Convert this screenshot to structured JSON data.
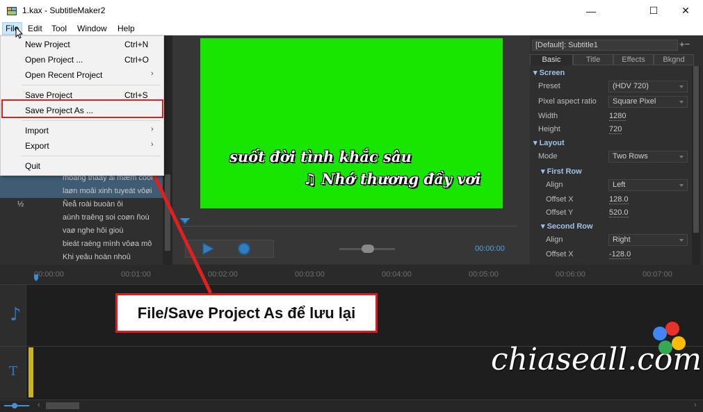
{
  "window": {
    "title": "1.kax - SubtitleMaker2",
    "minimize": "—",
    "maximize": "☐",
    "close": "✕"
  },
  "menubar": [
    "File",
    "Edit",
    "Tool",
    "Window",
    "Help"
  ],
  "file_menu": {
    "items": [
      {
        "label": "New Project",
        "shortcut": "Ctrl+N"
      },
      {
        "label": "Open Project ...",
        "shortcut": "Ctrl+O"
      },
      {
        "label": "Open Recent Project",
        "submenu": true
      },
      {
        "label": "Save Project",
        "shortcut": "Ctrl+S"
      },
      {
        "label": "Save Project As ...",
        "highlighted": true
      },
      {
        "label": "Import",
        "submenu": true
      },
      {
        "label": "Export",
        "submenu": true
      },
      {
        "label": "Quit"
      }
    ]
  },
  "subtitle_list": [
    {
      "index": "",
      "text": "moang thaay ai mæm cooi",
      "selected": true
    },
    {
      "index": "",
      "text": "laøn moâi xinh tuyeät vôøi",
      "selected": true
    },
    {
      "index": "½",
      "text": "Ñeå roài buoàn ôi",
      "selected": false
    },
    {
      "index": "",
      "text": "aùnh traêng soi coøn ñoù",
      "selected": false
    },
    {
      "index": "",
      "text": "vaø nghe hôi gioù",
      "selected": false
    },
    {
      "index": "",
      "text": "bieát raèng mình vôøa mô",
      "selected": false
    },
    {
      "index": "",
      "text": "Khi yeâu hoàn nhoû",
      "selected": false
    }
  ],
  "preview": {
    "line1": "suốt đời tình khắc sâu",
    "line2": "Nhớ thương đầy vơi",
    "line2_prefix": "♫",
    "time": "00:00:00",
    "background_color": "#19e600"
  },
  "properties": {
    "preset_name": "[Default]: Subtitle1",
    "add_remove": "+−",
    "tabs": [
      "Basic",
      "Title",
      "Effects",
      "Bkgnd"
    ],
    "active_tab": "Basic",
    "screen_section": "Screen",
    "preset_label": "Preset",
    "preset_value": "(HDV 720)",
    "pixel_label": "Pixel aspect ratio",
    "pixel_value": "Square Pixel",
    "width_label": "Width",
    "width_value": "1280",
    "height_label": "Height",
    "height_value": "720",
    "layout_section": "Layout",
    "mode_label": "Mode",
    "mode_value": "Two Rows",
    "first_row_section": "First Row",
    "align1_label": "Align",
    "align1_value": "Left",
    "offx1_label": "Offset X",
    "offx1_value": "128.0",
    "offy1_label": "Offset Y",
    "offy1_value": "520.0",
    "second_row_section": "Second Row",
    "align2_label": "Align",
    "align2_value": "Right",
    "offx2_label": "Offset X",
    "offx2_value": "-128.0"
  },
  "timeline": {
    "ticks": [
      "00:00:00",
      "00:01:00",
      "00:02:00",
      "00:03:00",
      "00:04:00",
      "00:05:00",
      "00:06:00",
      "00:07:00"
    ],
    "audio_track_icon": "♪",
    "text_track_icon": "T"
  },
  "annotation": {
    "callout_text": "File/Save Project As để lưu lại"
  },
  "watermark": {
    "text": "chiaseall.com",
    "dot_colors": [
      "#e8322b",
      "#4285f4",
      "#34a853",
      "#fbbc05"
    ]
  },
  "colors": {
    "accent_blue": "#4aa6e8",
    "highlight_red": "#e02020",
    "selection": "#405b74"
  }
}
